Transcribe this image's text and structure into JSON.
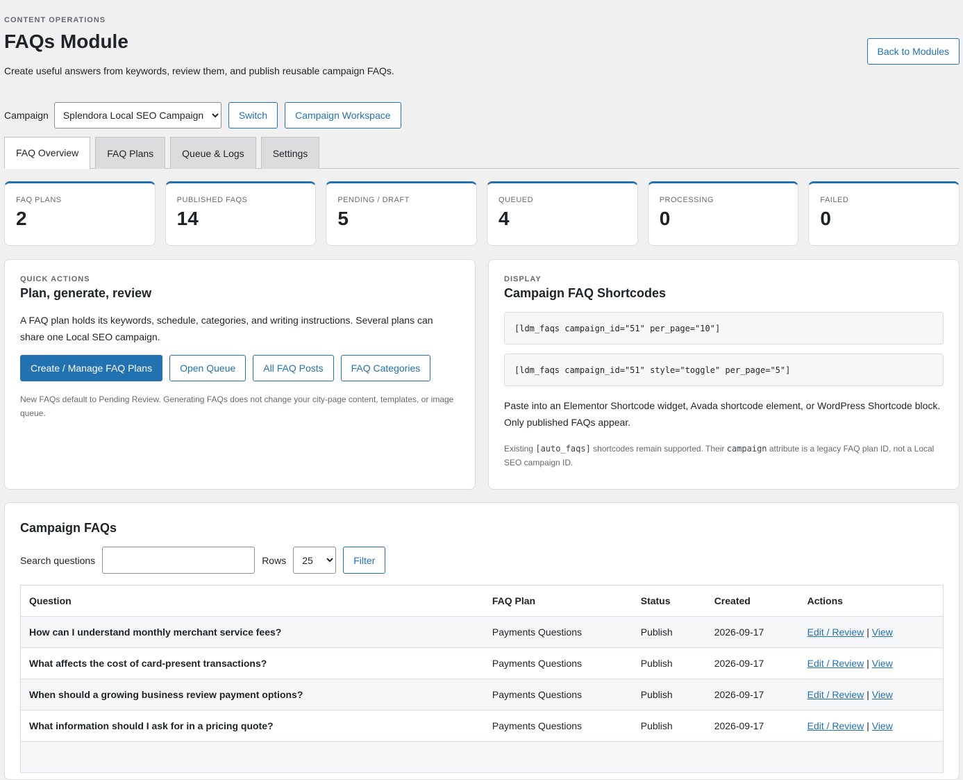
{
  "header": {
    "eyebrow": "CONTENT OPERATIONS",
    "title": "FAQs Module",
    "description": "Create useful answers from keywords, review them, and publish reusable campaign FAQs.",
    "back_label": "Back to Modules"
  },
  "campaign": {
    "label": "Campaign",
    "selected": "Splendora Local SEO Campaign",
    "switch_label": "Switch",
    "workspace_label": "Campaign Workspace"
  },
  "tabs": [
    {
      "label": "FAQ Overview",
      "active": true
    },
    {
      "label": "FAQ Plans",
      "active": false
    },
    {
      "label": "Queue & Logs",
      "active": false
    },
    {
      "label": "Settings",
      "active": false
    }
  ],
  "stats": [
    {
      "label": "FAQ PLANS",
      "value": "2"
    },
    {
      "label": "PUBLISHED FAQS",
      "value": "14"
    },
    {
      "label": "PENDING / DRAFT",
      "value": "5"
    },
    {
      "label": "QUEUED",
      "value": "4"
    },
    {
      "label": "PROCESSING",
      "value": "0"
    },
    {
      "label": "FAILED",
      "value": "0"
    }
  ],
  "quick_actions": {
    "eyebrow": "QUICK ACTIONS",
    "title": "Plan, generate, review",
    "body": "A FAQ plan holds its keywords, schedule, categories, and writing instructions. Several plans can share one Local SEO campaign.",
    "buttons": [
      "Create / Manage FAQ Plans",
      "Open Queue",
      "All FAQ Posts",
      "FAQ Categories"
    ],
    "note": "New FAQs default to Pending Review. Generating FAQs does not change your city-page content, templates, or image queue."
  },
  "display": {
    "eyebrow": "DISPLAY",
    "title": "Campaign FAQ Shortcodes",
    "shortcode_1": "[ldm_faqs campaign_id=\"51\" per_page=\"10\"]",
    "shortcode_2": "[ldm_faqs campaign_id=\"51\" style=\"toggle\" per_page=\"5\"]",
    "body": "Paste into an Elementor Shortcode widget, Avada shortcode element, or WordPress Shortcode block. Only published FAQs appear.",
    "note_pre": "Existing ",
    "note_code_1": "[auto_faqs]",
    "note_mid": " shortcodes remain supported. Their ",
    "note_code_2": "campaign",
    "note_post": " attribute is a legacy FAQ plan ID, not a Local SEO campaign ID."
  },
  "faqs": {
    "title": "Campaign FAQs",
    "search_label": "Search questions",
    "search_value": "",
    "rows_label": "Rows",
    "rows_value": "25",
    "filter_label": "Filter",
    "columns": [
      "Question",
      "FAQ Plan",
      "Status",
      "Created",
      "Actions"
    ],
    "edit_label": "Edit / Review",
    "separator": "|",
    "view_label": "View",
    "rows": [
      {
        "question": "How can I understand monthly merchant service fees?",
        "plan": "Payments Questions",
        "status": "Publish",
        "created": "2026-09-17"
      },
      {
        "question": "What affects the cost of card-present transactions?",
        "plan": "Payments Questions",
        "status": "Publish",
        "created": "2026-09-17"
      },
      {
        "question": "When should a growing business review payment options?",
        "plan": "Payments Questions",
        "status": "Publish",
        "created": "2026-09-17"
      },
      {
        "question": "What information should I ask for in a pricing quote?",
        "plan": "Payments Questions",
        "status": "Publish",
        "created": "2026-09-17"
      },
      {
        "question": "",
        "plan": "",
        "status": "",
        "created": ""
      }
    ]
  }
}
